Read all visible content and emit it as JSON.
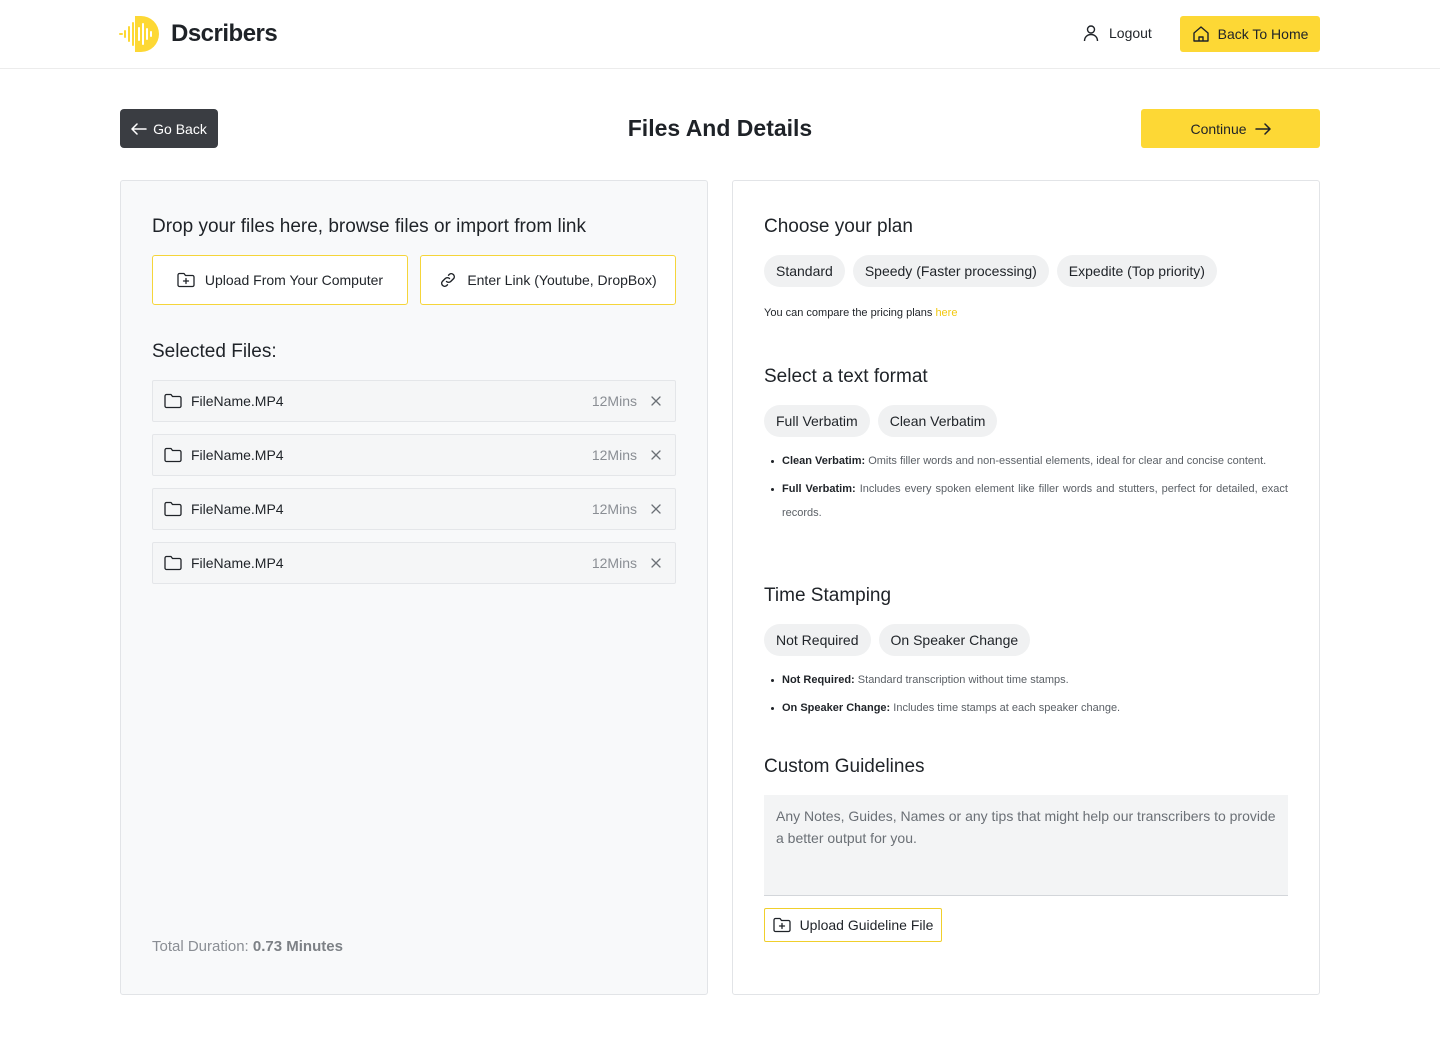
{
  "header": {
    "brand": "Dscribers",
    "logout_label": "Logout",
    "home_label": "Back To Home"
  },
  "toolbar": {
    "back_label": "Go Back",
    "title": "Files And Details",
    "continue_label": "Continue"
  },
  "upload": {
    "heading": "Drop your files here, browse files or import from link",
    "computer_label": "Upload From Your Computer",
    "link_label": "Enter Link (Youtube, DropBox)"
  },
  "files": {
    "heading": "Selected Files:",
    "items": [
      {
        "name": "FileName.MP4",
        "duration": "12Mins"
      },
      {
        "name": "FileName.MP4",
        "duration": "12Mins"
      },
      {
        "name": "FileName.MP4",
        "duration": "12Mins"
      },
      {
        "name": "FileName.MP4",
        "duration": "12Mins"
      }
    ],
    "total_label": "Total Duration:",
    "total_value": "0.73 Minutes"
  },
  "plan": {
    "title": "Choose your plan",
    "options": [
      "Standard",
      "Speedy (Faster processing)",
      "Expedite (Top priority)"
    ],
    "compare_text": "You can compare the pricing plans",
    "compare_link": "here"
  },
  "format": {
    "title": "Select a text format",
    "options": [
      "Full Verbatim",
      "Clean Verbatim"
    ],
    "notes": [
      {
        "term": "Clean Verbatim:",
        "text": "Omits filler words and non-essential elements, ideal for clear and concise content."
      },
      {
        "term": "Full Verbatim:",
        "text": "Includes every spoken element like filler words and stutters, perfect for detailed, exact records."
      }
    ]
  },
  "timestamps": {
    "title": "Time Stamping",
    "options": [
      "Not Required",
      "On Speaker Change"
    ],
    "notes": [
      {
        "term": "Not Required:",
        "text": "Standard transcription without time stamps."
      },
      {
        "term": "On Speaker Change:",
        "text": "Includes time stamps at each speaker change."
      }
    ]
  },
  "guidelines": {
    "title": "Custom Guidelines",
    "placeholder": "Any Notes, Guides, Names or any tips that might help our transcribers to provide a better output for you.",
    "upload_label": "Upload Guideline File"
  },
  "colors": {
    "accent": "#fdd835",
    "dark_button": "#3a3d42",
    "link": "#f2c811"
  }
}
